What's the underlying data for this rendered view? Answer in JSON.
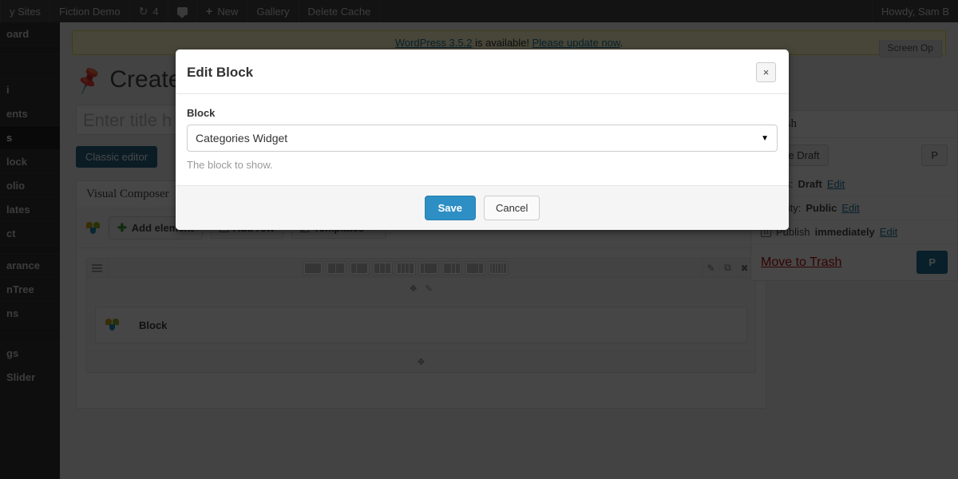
{
  "adminbar": {
    "items": [
      {
        "name": "my-sites",
        "label": "y Sites",
        "icon": ""
      },
      {
        "name": "site-name",
        "label": "Fiction Demo",
        "icon": ""
      },
      {
        "name": "updates",
        "label": "4",
        "icon": "refresh-icon"
      },
      {
        "name": "comments",
        "label": "",
        "icon": "comment-bubble-icon"
      },
      {
        "name": "new-content",
        "label": "New",
        "icon": "plus-icon"
      },
      {
        "name": "gallery",
        "label": "Gallery",
        "icon": ""
      },
      {
        "name": "delete-cache",
        "label": "Delete Cache",
        "icon": ""
      }
    ],
    "account": "Howdy, Sam B"
  },
  "screen_meta": {
    "screen_options_label": "Screen Op"
  },
  "update_nag": {
    "version_link": "WordPress 3.5.2",
    "middle": " is available! ",
    "update_link": "Please update now",
    "suffix": "."
  },
  "sidebar": {
    "items": [
      {
        "label": "oard",
        "current": false
      },
      {
        "label": "",
        "current": false
      },
      {
        "label": "",
        "current": false
      },
      {
        "label": "i",
        "current": false
      },
      {
        "label": "ents",
        "current": false
      },
      {
        "label": "s",
        "current": true
      },
      {
        "label": "",
        "current": false
      },
      {
        "label": "lock",
        "current": false
      },
      {
        "label": "olio",
        "current": false
      },
      {
        "label": "lates",
        "current": false
      },
      {
        "label": "ct",
        "current": false
      },
      {
        "label": "arance",
        "current": false
      },
      {
        "label": "nTree",
        "current": false
      },
      {
        "label": "ns",
        "current": false
      },
      {
        "label": "",
        "current": false
      },
      {
        "label": "gs",
        "current": false
      },
      {
        "label": "Slider",
        "current": false
      }
    ]
  },
  "page": {
    "title": "Create",
    "pin_icon": "pin-icon",
    "title_placeholder": "Enter title h",
    "classic_editor_label": "Classic editor"
  },
  "visual_composer": {
    "panel_title": "Visual Composer",
    "toolbar": {
      "add_element": "Add element",
      "add_row": "Add row",
      "templates": "Templates"
    },
    "row": {
      "layout_count": 9,
      "layouts": [
        [
          1
        ],
        [
          1,
          1
        ],
        [
          1,
          2
        ],
        [
          1,
          1,
          1
        ],
        [
          1,
          1,
          1,
          1
        ],
        [
          1,
          3
        ],
        [
          2,
          1,
          1
        ],
        [
          3,
          1
        ],
        [
          1,
          1,
          1,
          1,
          1,
          1
        ]
      ],
      "actions": [
        "edit-icon",
        "clone-icon",
        "delete-icon"
      ]
    },
    "element": {
      "title": "Block",
      "icon": "vc-block-icon"
    }
  },
  "publish": {
    "title": "Publish",
    "save_draft_label": "Save Draft",
    "preview_label": "P",
    "status_label": "Status:",
    "status_value": "Draft",
    "status_edit": "Edit",
    "visibility_label": "Visibility:",
    "visibility_value": "Public",
    "visibility_edit": "Edit",
    "schedule_prefix": "Publish",
    "schedule_value": "immediately",
    "schedule_edit": "Edit",
    "calendar_icon_day": "11",
    "trash_label": "Move to Trash",
    "publish_label": "P"
  },
  "modal": {
    "title": "Edit Block",
    "close_label": "×",
    "field_label": "Block",
    "selected_value": "Categories Widget",
    "caret": "▼",
    "help_text": "The block to show.",
    "save_label": "Save",
    "cancel_label": "Cancel"
  },
  "colors": {
    "adminbar_bg": "#464646",
    "sidebar_bg": "#333333",
    "link_blue": "#21759b",
    "save_button_blue": "#2d8fc4",
    "trash_red": "#bc0b0b",
    "nag_bg": "#fffbcc"
  }
}
